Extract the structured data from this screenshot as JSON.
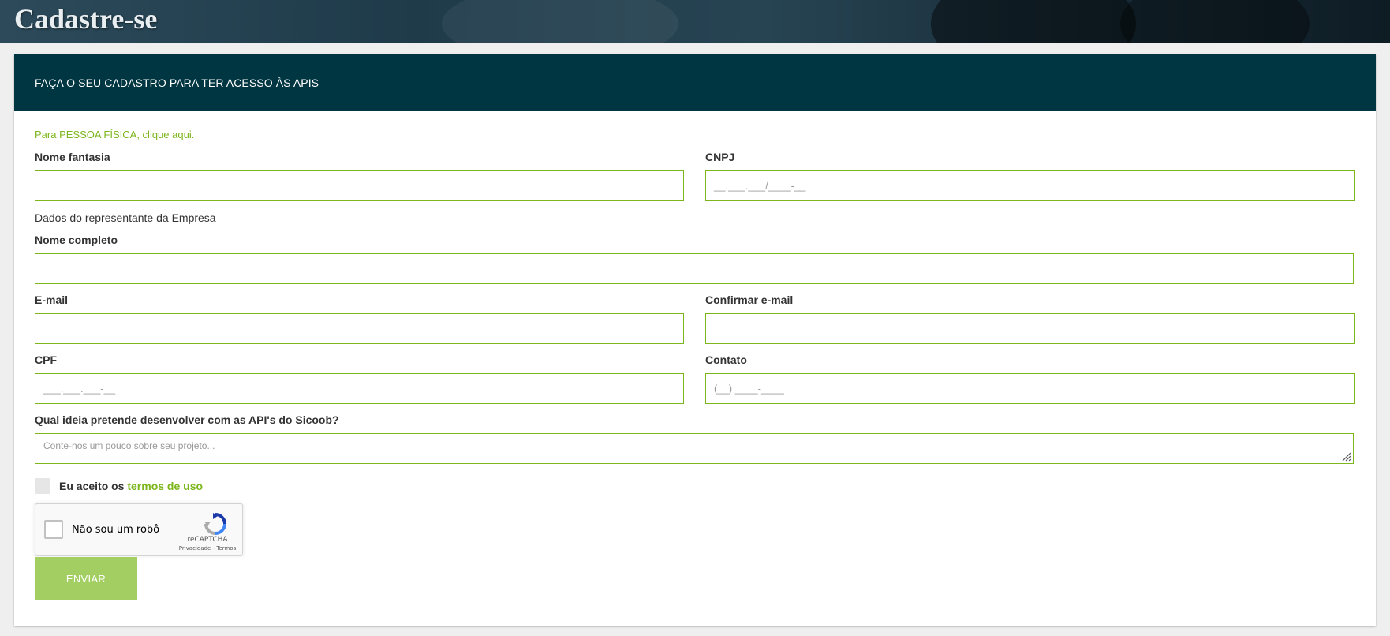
{
  "hero": {
    "title": "Cadastre-se"
  },
  "card": {
    "header": "FAÇA O SEU CADASTRO PARA TER ACESSO ÀS APIS"
  },
  "form": {
    "pf_link": "Para PESSOA FÍSICA, clique aqui.",
    "nome_fantasia": {
      "label": "Nome fantasia",
      "value": ""
    },
    "cnpj": {
      "label": "CNPJ",
      "mask": "__.___.___/____-__"
    },
    "representante_note": "Dados do representante da Empresa",
    "nome_completo": {
      "label": "Nome completo",
      "value": ""
    },
    "email": {
      "label": "E-mail",
      "value": ""
    },
    "confirmar_email": {
      "label": "Confirmar e-mail",
      "value": ""
    },
    "cpf": {
      "label": "CPF",
      "mask": "___.___.___-__"
    },
    "contato": {
      "label": "Contato",
      "mask": "(__) ____-____"
    },
    "ideia": {
      "label": "Qual ideia pretende desenvolver com as API's do Sicoob?",
      "placeholder": "Conte-nos um pouco sobre seu projeto..."
    },
    "accept_prefix": "Eu aceito os ",
    "accept_link": "termos de uso",
    "recaptcha": {
      "label": "Não sou um robô",
      "brand": "reCAPTCHA",
      "terms": "Privacidade - Termos"
    },
    "submit": "ENVIAR"
  },
  "colors": {
    "accent": "#7db61c",
    "header_bg": "#003641",
    "button_bg": "#a3cf62"
  }
}
